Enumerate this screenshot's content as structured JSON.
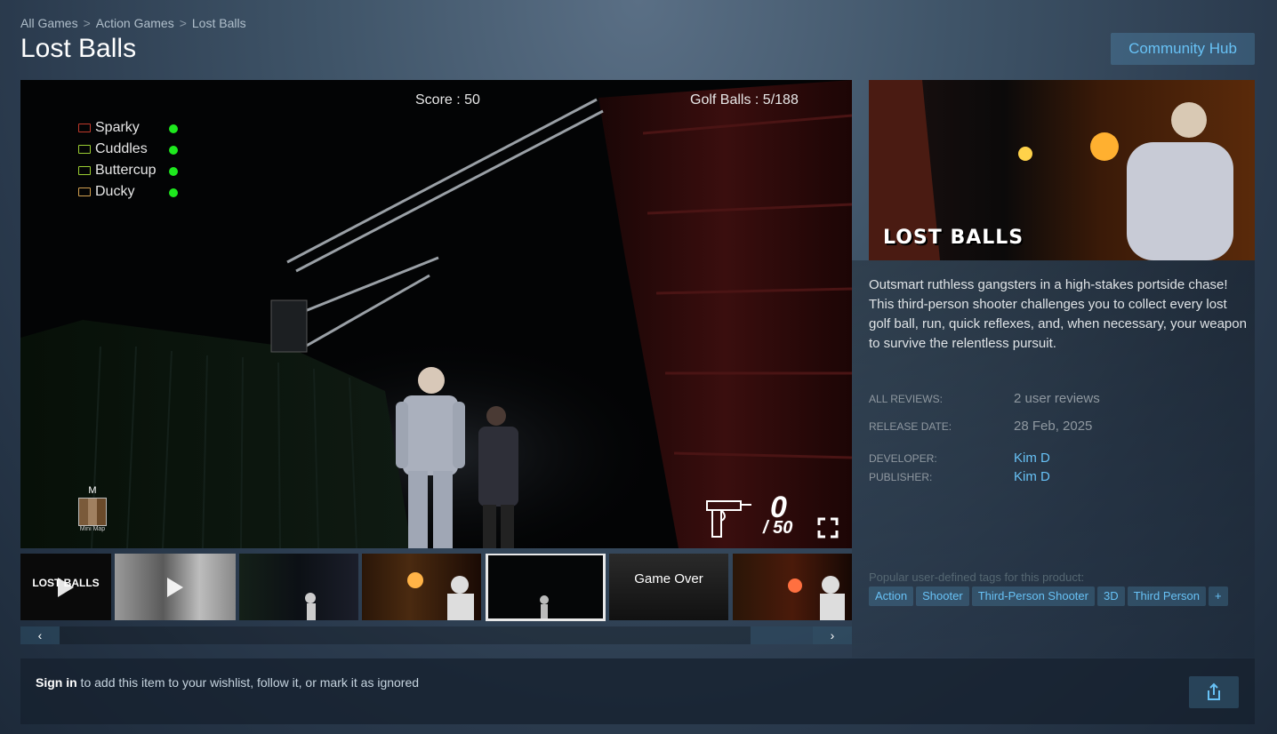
{
  "breadcrumb": {
    "items": [
      "All Games",
      "Action Games",
      "Lost Balls"
    ],
    "separator": ">"
  },
  "title": "Lost Balls",
  "community_hub_label": "Community Hub",
  "player": {
    "hud": {
      "score": "Score : 50",
      "golf_balls": "Golf Balls : 5/188",
      "players": [
        {
          "name": "Sparky",
          "gun_color": "#c0392b"
        },
        {
          "name": "Cuddles",
          "gun_color": "#9acd32"
        },
        {
          "name": "Buttercup",
          "gun_color": "#9acd32"
        },
        {
          "name": "Ducky",
          "gun_color": "#d2a050"
        }
      ],
      "status_color": "#1ee81e",
      "minimap_key": "M",
      "minimap_caption": "Mini Map",
      "ammo_current": "0",
      "ammo_max": "/ 50"
    }
  },
  "thumbnails": [
    {
      "type": "video",
      "label": "LOST BALLS"
    },
    {
      "type": "video",
      "label": ""
    },
    {
      "type": "image",
      "label": ""
    },
    {
      "type": "image",
      "label": ""
    },
    {
      "type": "image",
      "label": "",
      "selected": true
    },
    {
      "type": "image",
      "label": "Game Over"
    },
    {
      "type": "image",
      "label": ""
    }
  ],
  "slider": {
    "left_icon": "chevron-left-icon",
    "right_icon": "chevron-right-icon"
  },
  "capsule": {
    "logo_text": "LOST BALLS"
  },
  "description": "Outsmart ruthless gangsters in a high-stakes portside chase! This third-person shooter challenges you to collect every lost golf ball, run, quick reflexes, and, when necessary, your weapon to survive the relentless pursuit.",
  "info": {
    "all_reviews_label": "ALL REVIEWS:",
    "all_reviews_value": "2 user reviews",
    "release_date_label": "RELEASE DATE:",
    "release_date_value": "28 Feb, 2025",
    "developer_label": "DEVELOPER:",
    "developer_value": "Kim D",
    "publisher_label": "PUBLISHER:",
    "publisher_value": "Kim D"
  },
  "tags_label": "Popular user-defined tags for this product:",
  "tags": [
    "Action",
    "Shooter",
    "Third-Person Shooter",
    "3D",
    "Third Person",
    "+"
  ],
  "signin": {
    "link": "Sign in",
    "text": " to add this item to your wishlist, follow it, or mark it as ignored"
  },
  "colors": {
    "accent": "#67c1f5",
    "background": "#1b2838"
  }
}
